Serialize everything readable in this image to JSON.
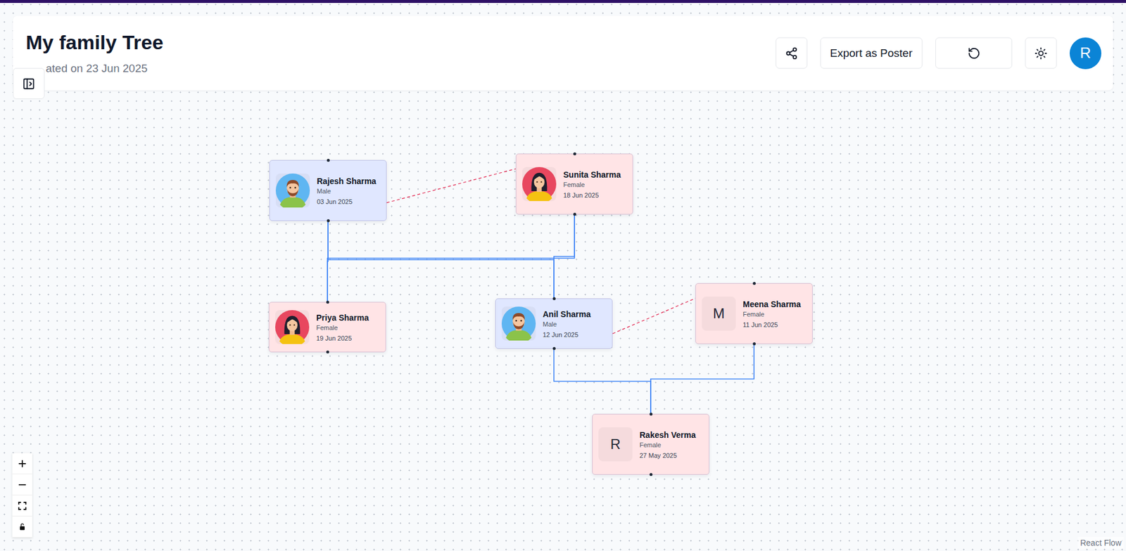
{
  "header": {
    "title": "My family Tree",
    "subtitle": "ated on 23 Jun 2025"
  },
  "sidebar_toggle": {
    "kind": "panel-open"
  },
  "toolbar": [
    {
      "kind": "share"
    },
    {
      "kind": "export",
      "label": "Export as Poster"
    },
    {
      "kind": "reset"
    },
    {
      "kind": "theme"
    }
  ],
  "user": {
    "initial": "R"
  },
  "nodes": [
    {
      "name": "Rajesh Sharma",
      "gender": "Male",
      "date": "03 Jun 2025",
      "avatar": {
        "kind": "male"
      },
      "color": "#e0e7ff"
    },
    {
      "name": "Sunita Sharma",
      "gender": "Female",
      "date": "18 Jun 2025",
      "avatar": {
        "kind": "female"
      },
      "color": "#ffe4e6"
    },
    {
      "name": "Priya Sharma",
      "gender": "Female",
      "date": "19 Jun 2025",
      "avatar": {
        "kind": "female"
      },
      "color": "#ffe4e6"
    },
    {
      "name": "Anil Sharma",
      "gender": "Male",
      "date": "12 Jun 2025",
      "avatar": {
        "kind": "male"
      },
      "color": "#e0e7ff"
    },
    {
      "name": "Meena Sharma",
      "gender": "Female",
      "date": "11 Jun 2025",
      "avatar": {
        "kind": "letter",
        "initial": "M"
      },
      "color": "#ffe4e6"
    },
    {
      "name": "Rakesh Verma",
      "gender": "Female",
      "date": "27 May 2025",
      "avatar": {
        "kind": "letter",
        "initial": "R"
      },
      "color": "#ffe4e6"
    }
  ],
  "edges": [
    {
      "from": 0,
      "to": 1,
      "kind": "spouse"
    },
    {
      "from": 0,
      "to": 2,
      "kind": "parent"
    },
    {
      "from": 1,
      "to": 2,
      "kind": "parent"
    },
    {
      "from": 0,
      "to": 3,
      "kind": "parent"
    },
    {
      "from": 1,
      "to": 3,
      "kind": "parent"
    },
    {
      "from": 3,
      "to": 4,
      "kind": "spouse"
    },
    {
      "from": 3,
      "to": 5,
      "kind": "parent"
    },
    {
      "from": 4,
      "to": 5,
      "kind": "parent"
    }
  ],
  "controls": [
    {
      "kind": "zoom-in"
    },
    {
      "kind": "zoom-out"
    },
    {
      "kind": "fit-view"
    },
    {
      "kind": "lock"
    }
  ],
  "attribution": "React Flow"
}
